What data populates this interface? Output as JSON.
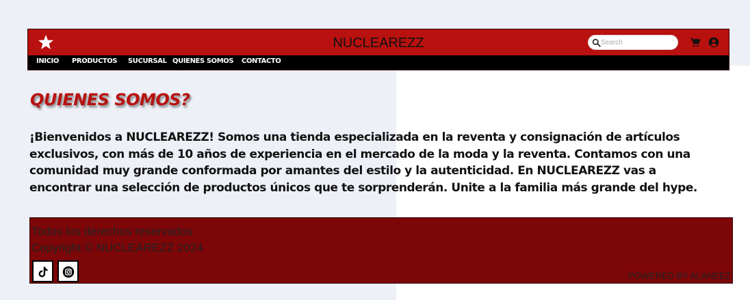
{
  "header": {
    "brand": "NUCLEAREZZ",
    "search_placeholder": "Search",
    "logo_icon": "star-icon",
    "cart_icon": "cart-icon",
    "user_icon": "user-account-icon"
  },
  "nav": {
    "items": [
      {
        "label": "INICIO"
      },
      {
        "label": "PRODUCTOS"
      },
      {
        "label": "SUCURSAL"
      },
      {
        "label": "QUIENES SOMOS"
      },
      {
        "label": "CONTACTO"
      }
    ]
  },
  "main": {
    "title": "QUIENES SOMOS?",
    "paragraph": "¡Bienvenidos a NUCLEAREZZ! Somos una tienda especializada en la reventa y consignación de artículos exclusivos, con más de 10 años de experiencia en el mercado de la moda y la reventa. Contamos con una comunidad muy grande conformada por amantes del estilo y la autenticidad. En NUCLEAREZZ vas a encontrar una selección de productos únicos que te sorprenderán. Unite a la familia más grande del hype."
  },
  "footer": {
    "rights": "Todos los derechos reservados",
    "copyright": "Copyright © NUCLEAREZZ 2024",
    "powered": "POWERED BY ALANEEZ",
    "social": [
      {
        "icon": "tiktok-icon"
      },
      {
        "icon": "instagram-icon"
      }
    ]
  },
  "colors": {
    "topbar": "#b8110f",
    "navbar": "#000000",
    "footer": "#7d0608",
    "title": "#b8110f",
    "page_bg": "#edf0f6"
  }
}
